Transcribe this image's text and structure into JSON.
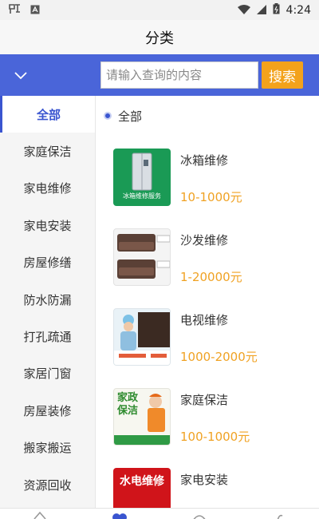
{
  "status": {
    "time": "4:24"
  },
  "header": {
    "title": "分类"
  },
  "search": {
    "placeholder": "请输入查询的内容",
    "button_label": "搜索"
  },
  "sidebar": {
    "items": [
      {
        "label": "全部",
        "active": true
      },
      {
        "label": "家庭保洁"
      },
      {
        "label": "家电维修"
      },
      {
        "label": "家电安装"
      },
      {
        "label": "房屋修缮"
      },
      {
        "label": "防水防漏"
      },
      {
        "label": "打孔疏通"
      },
      {
        "label": "家居门窗"
      },
      {
        "label": "房屋装修"
      },
      {
        "label": "搬家搬运"
      },
      {
        "label": "资源回收"
      }
    ]
  },
  "filter": {
    "label": "全部"
  },
  "products": [
    {
      "name": "冰箱维修",
      "price": "10-1000元",
      "thumb_caption": "冰箱维修服务",
      "thumb_bg": "#1a9a55"
    },
    {
      "name": "沙发维修",
      "price": "1-20000元",
      "thumb_caption": "",
      "thumb_bg": "#f2f2f2"
    },
    {
      "name": "电视维修",
      "price": "1000-2000元",
      "thumb_caption": "",
      "thumb_bg": "#e9f2f7"
    },
    {
      "name": "家庭保洁",
      "price": "100-1000元",
      "thumb_caption": "家政保洁",
      "thumb_bg": "#f7f7f0"
    },
    {
      "name": "家电安装",
      "price": "",
      "thumb_caption": "水电维修",
      "thumb_bg": "#d0141a"
    }
  ],
  "colors": {
    "accent": "#4a65d9",
    "price": "#f0a223",
    "search_button": "#f3a21b"
  }
}
